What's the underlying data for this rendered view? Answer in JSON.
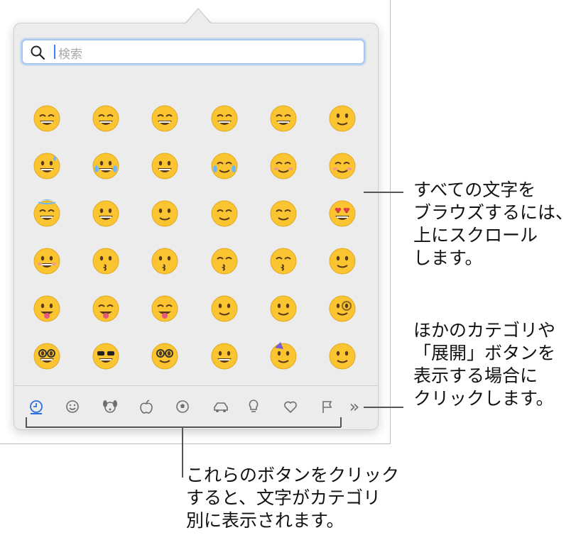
{
  "search": {
    "placeholder": "検索"
  },
  "emoji_rows": [
    [
      "grinning",
      "smiley",
      "smile",
      "grin",
      "laughing",
      "pleading"
    ],
    [
      "sweat-smile",
      "joy",
      "rofl",
      "holding-tears",
      "relaxed",
      "blush"
    ],
    [
      "innocent",
      "slight-smile",
      "upside-down",
      "wink",
      "relieved",
      "heart-eyes"
    ],
    [
      "smiling-hearts",
      "kissing-heart",
      "kissing",
      "kissing-smiling-eyes",
      "kissing-closed-eyes",
      "yum"
    ],
    [
      "tongue",
      "squint-tongue",
      "wink-tongue",
      "zany",
      "raised-eyebrow",
      "monocle"
    ],
    [
      "nerd",
      "sunglasses",
      "disguised",
      "star-struck",
      "partying",
      "shaking-face"
    ]
  ],
  "tabs": [
    "recent-icon",
    "smileys-icon",
    "animals-icon",
    "food-icon",
    "activity-icon",
    "travel-icon",
    "objects-icon",
    "symbols-icon",
    "flags-icon"
  ],
  "expand_label": "»",
  "callouts": {
    "scroll": [
      "すべての文字を",
      "ブラウズするには、",
      "上にスクロール",
      "します。"
    ],
    "expand": [
      "ほかのカテゴリや",
      "「展開」ボタンを",
      "表示する場合に",
      "クリックします。"
    ],
    "categories": [
      "これらのボタンをクリック",
      "すると、文字がカテゴリ",
      "別に表示されます。"
    ]
  },
  "colors": {
    "accent": "#2c6fdc",
    "emoji_face": "#fbc531"
  }
}
